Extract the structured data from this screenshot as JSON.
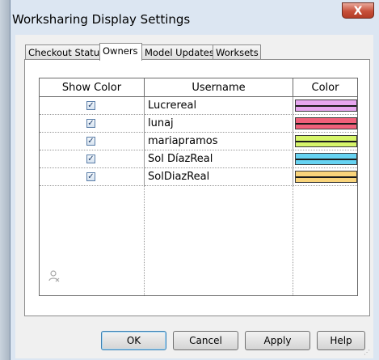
{
  "window": {
    "title": "Worksharing Display Settings",
    "close_label": "X"
  },
  "tabs": [
    {
      "label": "Checkout Status",
      "active": false
    },
    {
      "label": "Owners",
      "active": true
    },
    {
      "label": "Model Updates",
      "active": false
    },
    {
      "label": "Worksets",
      "active": false
    }
  ],
  "table": {
    "headers": {
      "show_color": "Show Color",
      "username": "Username",
      "color": "Color"
    },
    "rows": [
      {
        "checked": true,
        "check_glyph": "✓",
        "username": "Lucrereal",
        "color": "#e7a6f0"
      },
      {
        "checked": true,
        "check_glyph": "✓",
        "username": "lunaj",
        "color": "#f0607a"
      },
      {
        "checked": true,
        "check_glyph": "✓",
        "username": "mariapramos",
        "color": "#d6f56a"
      },
      {
        "checked": true,
        "check_glyph": "✓",
        "username": "Sol DíazReal",
        "color": "#66d3f2"
      },
      {
        "checked": true,
        "check_glyph": "✓",
        "username": "SolDiazReal",
        "color": "#f9d47a"
      }
    ]
  },
  "icons": {
    "remove_user": "user-remove-icon"
  },
  "buttons": {
    "ok": "OK",
    "cancel": "Cancel",
    "apply": "Apply",
    "help": "Help"
  }
}
